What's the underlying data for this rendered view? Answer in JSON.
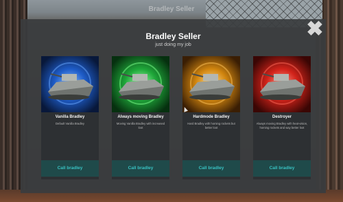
{
  "background": {
    "top_title": "Bradley Seller"
  },
  "header": {
    "title": "Bradley Seller",
    "subtitle": "just doing my job",
    "close_icon": "close-icon"
  },
  "cards": [
    {
      "name": "Vanilla Bradley",
      "description": "Default Vanilla Bradley",
      "button_label": "Call bradley",
      "accent": "#1e5cc8"
    },
    {
      "name": "Always moving Bradley",
      "description": "Moving Vanilla Bradley with increased loot",
      "button_label": "Call bradley",
      "accent": "#1fa83a"
    },
    {
      "name": "Hardmode Bradley",
      "description": "Hard Bradley with homing rockets but better loot",
      "button_label": "Call bradley",
      "accent": "#d2860f"
    },
    {
      "name": "Destroyer",
      "description": "Always moving Bradley with heat-vision, homing rockets and way better loot",
      "button_label": "Call bradley",
      "accent": "#d2231a"
    }
  ],
  "colors": {
    "panel": "#3a3c3e",
    "card": "#2d3033",
    "button_bg": "#1f4a4a",
    "button_text": "#39c2c2"
  }
}
